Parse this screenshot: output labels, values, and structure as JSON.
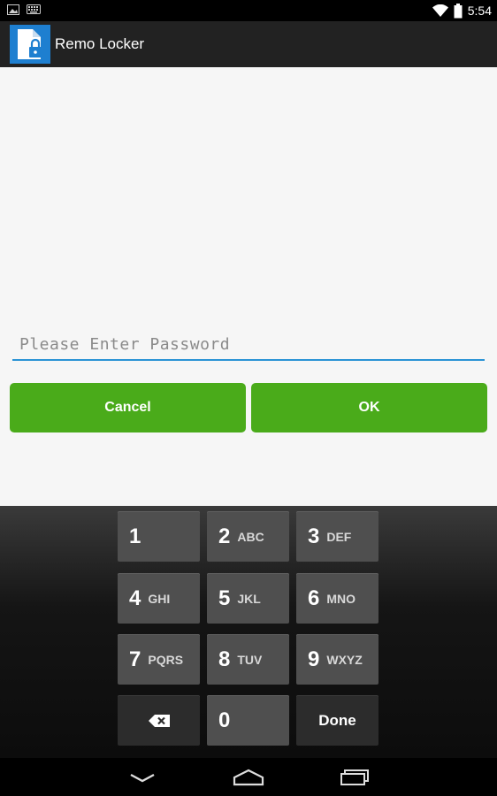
{
  "status_bar": {
    "time": "5:54",
    "icons": [
      "image-notification-icon",
      "keyboard-notification-icon",
      "wifi-icon",
      "battery-icon"
    ]
  },
  "action_bar": {
    "title": "Remo Locker",
    "app_icon": "lock-document-icon"
  },
  "form": {
    "password_placeholder": "Please Enter Password",
    "password_value": "",
    "cancel_label": "Cancel",
    "ok_label": "OK",
    "accent": "#2a93d5",
    "button_color": "#4aab1a"
  },
  "keypad": {
    "keys": [
      {
        "num": "1",
        "letters": ""
      },
      {
        "num": "2",
        "letters": "ABC"
      },
      {
        "num": "3",
        "letters": "DEF"
      },
      {
        "num": "4",
        "letters": "GHI"
      },
      {
        "num": "5",
        "letters": "JKL"
      },
      {
        "num": "6",
        "letters": "MNO"
      },
      {
        "num": "7",
        "letters": "PQRS"
      },
      {
        "num": "8",
        "letters": "TUV"
      },
      {
        "num": "9",
        "letters": "WXYZ"
      },
      {
        "num": "0",
        "letters": ""
      }
    ],
    "backspace_icon": "backspace-icon",
    "done_label": "Done"
  },
  "nav_bar": {
    "icons": [
      "back-icon",
      "home-icon",
      "recent-apps-icon"
    ]
  }
}
